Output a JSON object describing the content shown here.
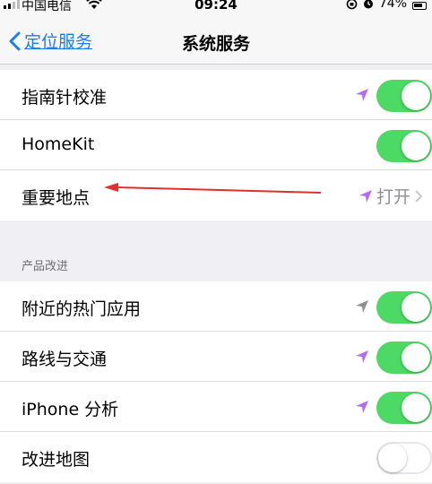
{
  "status_bar": {
    "carrier": "中国电信",
    "time": "09:24",
    "battery": "74%"
  },
  "nav": {
    "back_label": "定位服务",
    "title": "系统服务"
  },
  "top_group": [
    {
      "label": "指南针校准",
      "control": "toggle",
      "on": true,
      "arrow": "purple"
    },
    {
      "label": "HomeKit",
      "control": "toggle",
      "on": true
    },
    {
      "label": "重要地点",
      "control": "detail",
      "value": "打开",
      "arrow": "purple"
    }
  ],
  "section": {
    "header": "产品改进"
  },
  "bottom_group": [
    {
      "label": "附近的热门应用",
      "control": "toggle",
      "on": true,
      "arrow": "gray"
    },
    {
      "label": "路线与交通",
      "control": "toggle",
      "on": true,
      "arrow": "purple"
    },
    {
      "label": "iPhone 分析",
      "control": "toggle",
      "on": true,
      "arrow": "purple"
    },
    {
      "label": "改进地图",
      "control": "toggle",
      "on": false
    }
  ],
  "colors": {
    "tint": "#1a7df5",
    "toggle_on": "#4cd964",
    "arrow_purple": "#b26cf0",
    "arrow_gray": "#8e8e93",
    "annotation": "#e0302c"
  }
}
